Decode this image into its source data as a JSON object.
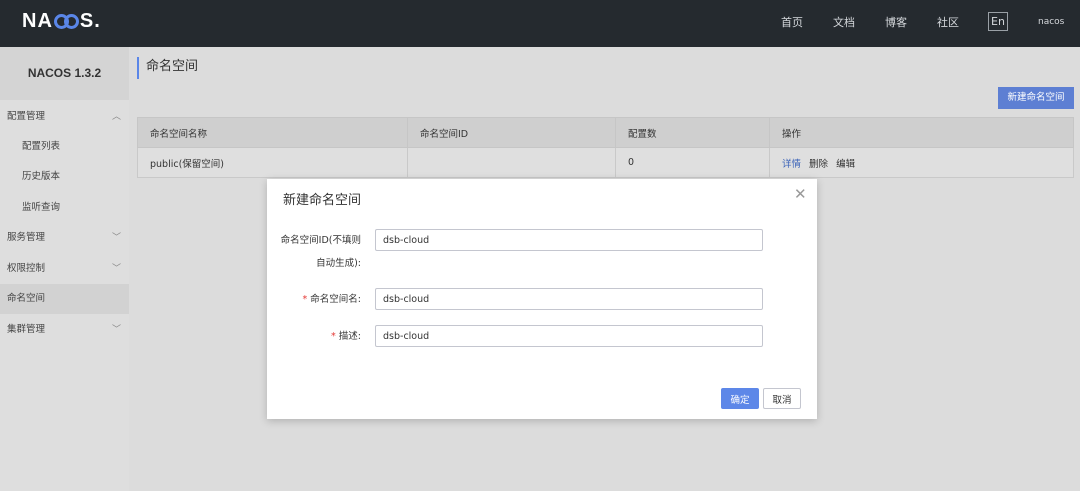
{
  "header": {
    "logo_text": "NACOS.",
    "nav": [
      "首页",
      "文档",
      "博客",
      "社区"
    ],
    "lang": "En",
    "user": "nacos"
  },
  "sidebar": {
    "version": "NACOS 1.3.2",
    "items": [
      {
        "label": "配置管理"
      },
      {
        "label": "配置列表"
      },
      {
        "label": "历史版本"
      },
      {
        "label": "监听查询"
      },
      {
        "label": "服务管理"
      },
      {
        "label": "权限控制"
      },
      {
        "label": "命名空间"
      },
      {
        "label": "集群管理"
      }
    ]
  },
  "main": {
    "title": "命名空间",
    "new_button": "新建命名空间",
    "table": {
      "headers": [
        "命名空间名称",
        "命名空间ID",
        "配置数",
        "操作"
      ],
      "rows": [
        {
          "name": "public(保留空间)",
          "id": "",
          "count": "0",
          "ops": [
            "详情",
            "删除",
            "编辑"
          ]
        }
      ]
    }
  },
  "dialog": {
    "title": "新建命名空间",
    "id_label_line1": "命名空间ID(不填则",
    "id_label_line2": "自动生成):",
    "id_value": "dsb-cloud",
    "name_label": "命名空间名:",
    "name_value": "dsb-cloud",
    "desc_label": "描述:",
    "desc_value": "dsb-cloud",
    "required_mark": "*",
    "ok": "确定",
    "cancel": "取消"
  }
}
